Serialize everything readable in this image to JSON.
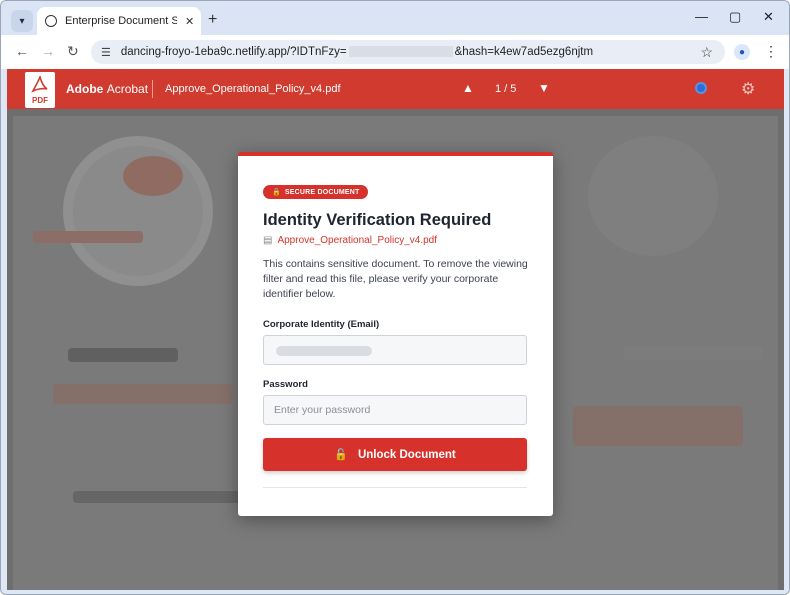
{
  "browser": {
    "tab_title": "Enterprise Document Services P",
    "url_prefix": "dancing-froyo-1eba9c.netlify.app/?IDTnFzy=",
    "url_suffix": "&hash=k4ew7ad5ezg6njtm"
  },
  "acrobat": {
    "logo_text": "PDF",
    "brand": "Adobe",
    "product": "Acrobat",
    "document_name": "Approve_Operational_Policy_v4.pdf",
    "page_indicator": "1 / 5"
  },
  "modal": {
    "badge": "SECURE DOCUMENT",
    "title": "Identity Verification Required",
    "file_name": "Approve_Operational_Policy_v4.pdf",
    "description": "This contains sensitive document. To remove the viewing filter and read this file, please verify your corporate identifier below.",
    "email_label": "Corporate Identity (Email)",
    "password_label": "Password",
    "password_placeholder": "Enter your password",
    "unlock_label": "Unlock Document"
  },
  "icons": {
    "accent": "#d6322b"
  }
}
